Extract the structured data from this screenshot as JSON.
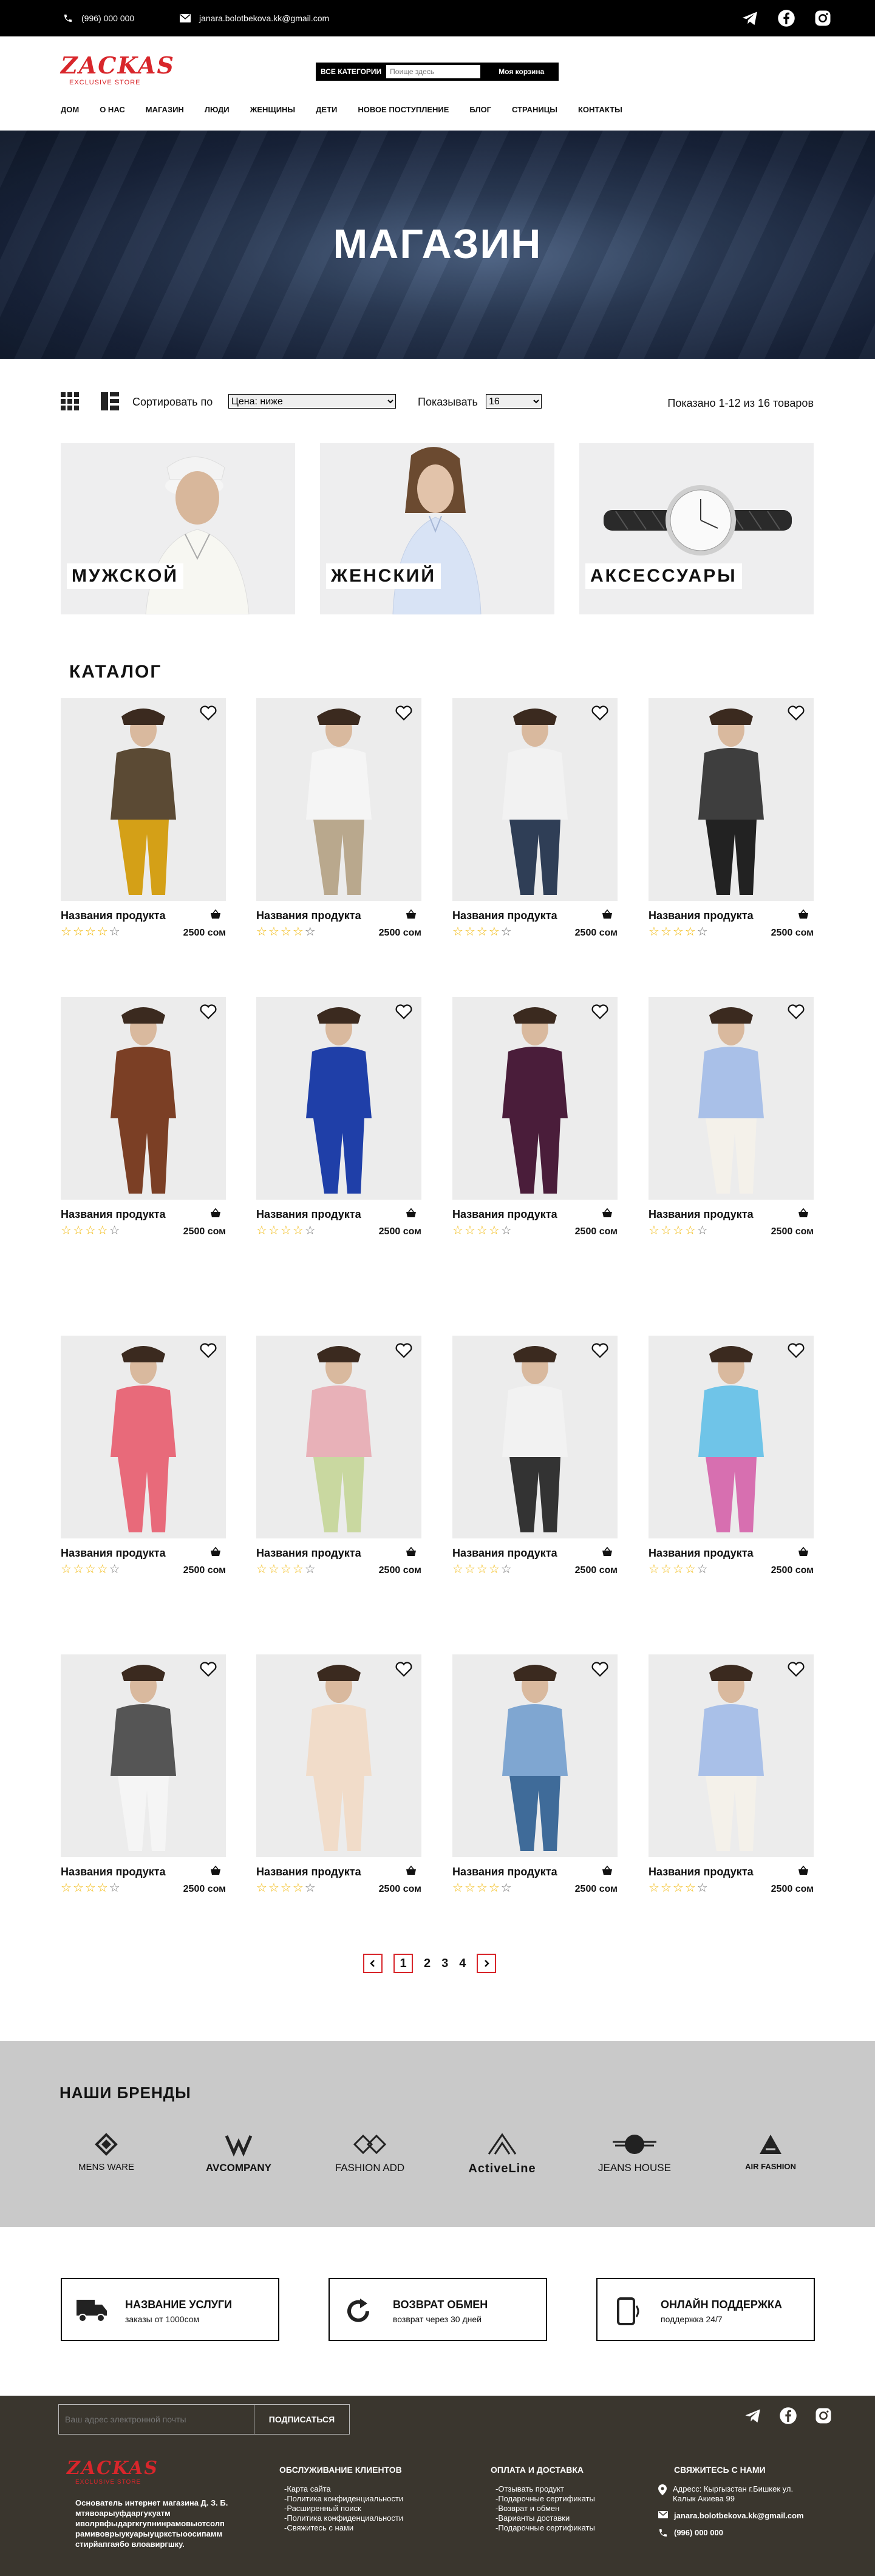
{
  "topbar": {
    "phone": "(996) 000 000",
    "email": "janara.bolotbekova.kk@gmail.com",
    "social_icons": [
      "telegram-icon",
      "facebook-icon",
      "instagram-icon"
    ]
  },
  "header": {
    "logo_main": "ZACKAS",
    "logo_sub": "EXCLUSIVE STORE",
    "category_label": "ВСЕ КАТЕГОРИИ",
    "search_placeholder": "Поище здесь",
    "cart_label": "Моя корзина"
  },
  "nav": [
    "ДОМ",
    "О НАС",
    "МАГАЗИН",
    "ЛЮДИ",
    "ЖЕНЩИНЫ",
    "ДЕТИ",
    "НОВОЕ ПОСТУПЛЕНИЕ",
    "БЛОГ",
    "СТРАНИЦЫ",
    "КОНТАКТЫ"
  ],
  "hero": {
    "title": "МАГАЗИН"
  },
  "toolbar": {
    "sort_label": "Сортировать по",
    "sort_value": "Цена: ниже",
    "show_label": "Показывать",
    "show_value": "16",
    "count_text": "Показано 1-12 из 16 товаров"
  },
  "categories": [
    "МУЖСКОЙ",
    "ЖЕНСКИЙ",
    "АКСЕССУАРЫ"
  ],
  "catalog_title": "КАТАЛОГ",
  "products": [
    {
      "name": "Названия продукта",
      "price": "2500 сом",
      "rating": 4
    },
    {
      "name": "Названия продукта",
      "price": "2500 сом",
      "rating": 4
    },
    {
      "name": "Названия продукта",
      "price": "2500 сом",
      "rating": 4
    },
    {
      "name": "Названия продукта",
      "price": "2500 сом",
      "rating": 4
    },
    {
      "name": "Названия продукта",
      "price": "2500 сом",
      "rating": 4
    },
    {
      "name": "Названия продукта",
      "price": "2500 сом",
      "rating": 4
    },
    {
      "name": "Названия продукта",
      "price": "2500 сом",
      "rating": 4
    },
    {
      "name": "Названия продукта",
      "price": "2500 сом",
      "rating": 4
    },
    {
      "name": "Названия продукта",
      "price": "2500 сом",
      "rating": 4
    },
    {
      "name": "Названия продукта",
      "price": "2500 сом",
      "rating": 4
    },
    {
      "name": "Названия продукта",
      "price": "2500 сом",
      "rating": 4
    },
    {
      "name": "Названия продукта",
      "price": "2500 сом",
      "rating": 4
    },
    {
      "name": "Названия продукта",
      "price": "2500 сом",
      "rating": 4
    },
    {
      "name": "Названия продукта",
      "price": "2500 сом",
      "rating": 4
    },
    {
      "name": "Названия продукта",
      "price": "2500 сом",
      "rating": 4
    },
    {
      "name": "Названия продукта",
      "price": "2500 сом",
      "rating": 4
    }
  ],
  "pagination": {
    "pages": [
      "1",
      "2",
      "3",
      "4"
    ],
    "current": "1"
  },
  "brands": {
    "title": "НАШИ БРЕНДЫ",
    "items": [
      "MENS WARE",
      "AVCOMPANY",
      "FASHION ADD",
      "ActiveLine",
      "JEANS HOUSE",
      "AIR FASHION"
    ]
  },
  "services": [
    {
      "title": "НАЗВАНИЕ УСЛУГИ",
      "subtitle": "заказы от 1000сом",
      "icon": "truck-icon"
    },
    {
      "title": "ВОЗВРАТ ОБМЕН",
      "subtitle": "возврат через 30 дней",
      "icon": "refresh-icon"
    },
    {
      "title": "ОНЛАЙН ПОДДЕРЖКА",
      "subtitle": "поддержка 24/7",
      "icon": "phone-icon"
    }
  ],
  "footer": {
    "email_placeholder": "Ваш адрес электронной почты",
    "subscribe_label": "ПОДПИСАТЬСЯ",
    "logo_main": "ZACKAS",
    "logo_sub": "EXCLUSIVE STORE",
    "about": "Основатель интернет магазина Д. З. Б. мтявоарыуфдаргукуатм иволрвфыдаргкгупнинрамовыотсолп рамивоврыукуарыуцркстыоосипамм стирйапгаябо влоавиргшку.",
    "customer_service": {
      "title": "ОБСЛУЖИВАНИЕ КЛИЕНТОВ",
      "items": [
        "-Карта сайта",
        "-Политика конфиденциальности",
        "-Расширенный поиск",
        "-Политика конфиденциальности",
        "-Свяжитесь с нами"
      ]
    },
    "payment": {
      "title": "ОПЛАТА И ДОСТАВКА",
      "items": [
        "-Отзывать продукт",
        "-Подарочные сертификаты",
        "-Возврат и обмен",
        "-Варианты доставки",
        "-Подарочные сертификаты"
      ]
    },
    "contact": {
      "title": "СВЯЖИТЕСЬ С НАМИ",
      "address": "Адресс: Кыргызстан  г.Бишкек ул. Калык Акиева 99",
      "email": "janara.bolotbekova.kk@gmail.com",
      "phone": "(996) 000 000"
    }
  },
  "colors": {
    "accent": "#d8262b",
    "footer_bg": "#3a362e",
    "brands_bg": "#c9c9c9",
    "star": "#f2b705"
  }
}
